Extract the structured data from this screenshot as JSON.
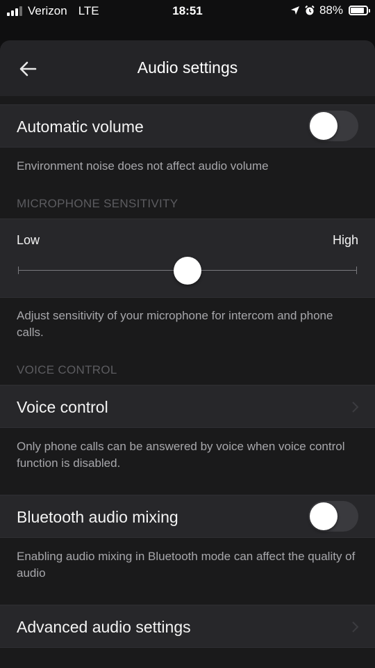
{
  "status_bar": {
    "carrier": "Verizon",
    "network": "LTE",
    "time": "18:51",
    "battery": "88%",
    "battery_level": 0.88,
    "icons": [
      "location-arrow-icon",
      "alarm-icon"
    ]
  },
  "header": {
    "title": "Audio settings",
    "back_icon": "arrow-left-icon"
  },
  "automatic_volume": {
    "label": "Automatic volume",
    "enabled": false,
    "description": "Environment noise does not affect audio volume"
  },
  "microphone": {
    "section_title": "MICROPHONE SENSITIVITY",
    "low_label": "Low",
    "high_label": "High",
    "level": 0.5,
    "description": "Adjust sensitivity of your microphone for intercom and phone calls."
  },
  "voice": {
    "section_title": "VOICE CONTROL",
    "label": "Voice control",
    "description": "Only phone calls can be answered by voice when voice control function is disabled."
  },
  "bluetooth": {
    "label": "Bluetooth audio mixing",
    "enabled": false,
    "description": "Enabling audio mixing in Bluetooth mode can affect the quality of audio"
  },
  "advanced": {
    "label": "Advanced audio settings"
  },
  "colors": {
    "background": "#0f0f10",
    "sheet": "#1a1a1b",
    "row": "#27272a",
    "secondary_text": "#a7a7ab",
    "section_header": "#5c5c60"
  }
}
